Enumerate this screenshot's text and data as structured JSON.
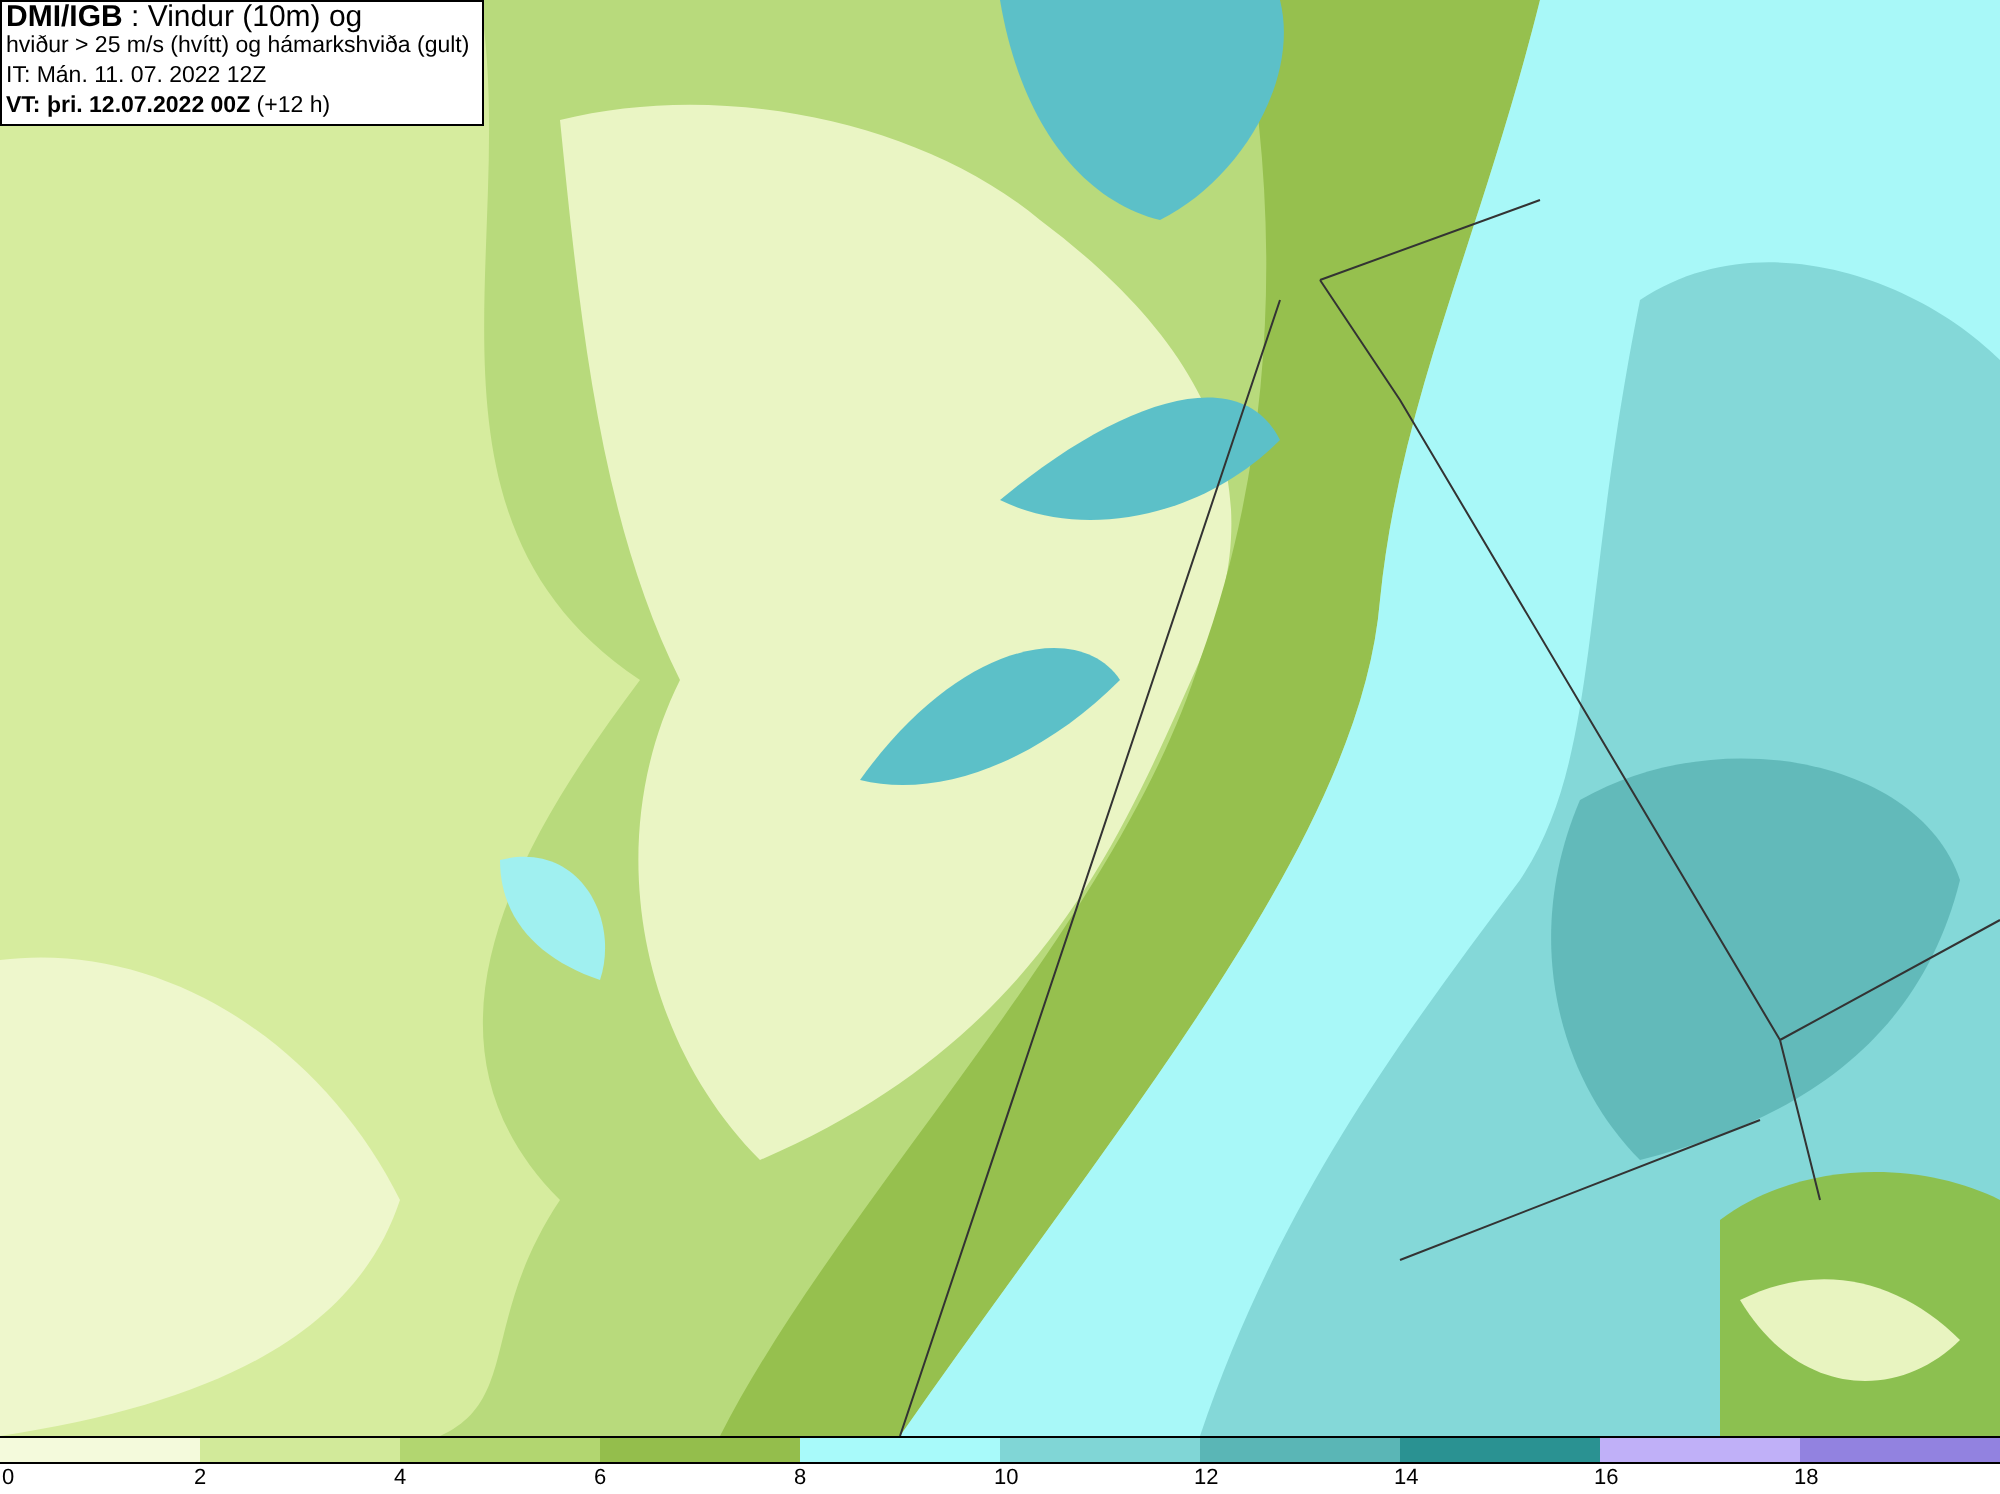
{
  "header": {
    "lines": [
      "**DMI/IGB** : Vindur (10m) og",
      "hviður > 25 m/s (hvítt) og hámarkshviða (gult)",
      "IT: Mán. 11. 07. 2022 12Z",
      "**VT: þri. 12.07.2022 00Z** (+12 h)"
    ]
  },
  "legend": {
    "bins": [
      {
        "color": "#f4fadc"
      },
      {
        "color": "#d2ea9a"
      },
      {
        "color": "#b2d670"
      },
      {
        "color": "#94be4c"
      },
      {
        "color": "#a8fafa"
      },
      {
        "color": "#80d6d6"
      },
      {
        "color": "#5ab6b6"
      },
      {
        "color": "#2a9292"
      },
      {
        "color": "#c0b0f8"
      },
      {
        "color": "#9282e0"
      }
    ],
    "labels": [
      "0",
      "2",
      "4",
      "6",
      "8",
      "10",
      "12",
      "14",
      "16",
      "18"
    ]
  }
}
